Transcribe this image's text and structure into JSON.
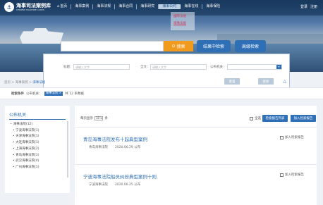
{
  "brand": {
    "logo_char": "⚓",
    "title": "海事司法案例库",
    "subtitle": "CHINESE MARITIME CASES"
  },
  "nav": {
    "items": [
      "首页",
      "海事案例",
      "海事法规",
      "海事合同",
      "海事研究",
      "海事公约",
      "海事在线",
      "海事保险"
    ],
    "active_index": 5,
    "dropdown": [
      "國際法規",
      "海事法规"
    ]
  },
  "auth": {
    "login": "登录",
    "register": "注册"
  },
  "search": {
    "button": "搜索",
    "mid_button": "结果中检索",
    "advanced_button": "高级检索"
  },
  "advanced": {
    "title_label": "标题：",
    "title_placeholder": "请输入文字",
    "body_label": "全文：",
    "body_placeholder": "请输入文字",
    "org_label": "公布机关：",
    "reset": "重置",
    "submit": "搜索"
  },
  "breadcrumb": {
    "parts": [
      "首页",
      "海事案例",
      "海事法规"
    ],
    "sep": " > "
  },
  "conditions": {
    "label": "检索条件",
    "field_label": "公布机关：",
    "tag": "海事法院",
    "count_text": "共 12 条数据"
  },
  "sidebar": {
    "title": "公布机关",
    "root": "海事法院(12)",
    "items": [
      "宁波海事法院(1)",
      "天津海事法院(1)",
      "大连海事法院(1)",
      "上海海事法院(2)",
      "青岛海事法院(1)",
      "武汉海事法院(4)",
      "广州海事法院(1)"
    ]
  },
  "toolbar": {
    "per_page_prefix": "每页显示",
    "per_page_value": "10",
    "per_page_suffix": "条",
    "select_all": "全选",
    "export_btn": "检索报告列表",
    "report_btn": "加入检索报告"
  },
  "results": [
    {
      "title": "青岛海事法院发布十起典型案例",
      "org": "青岛海事法院",
      "date": "2020.06.29 公布",
      "add_label": "加入检索报告"
    },
    {
      "title": "宁波海事法院船员纠纷典型案例十则",
      "org": "宁波海事法院",
      "date": "2020.06.25 公布",
      "add_label": "加入检索报告"
    }
  ],
  "colors": {
    "accent": "#2e6fb6",
    "search_btn": "#f09a1e",
    "dropdown_text": "#c6365a"
  }
}
